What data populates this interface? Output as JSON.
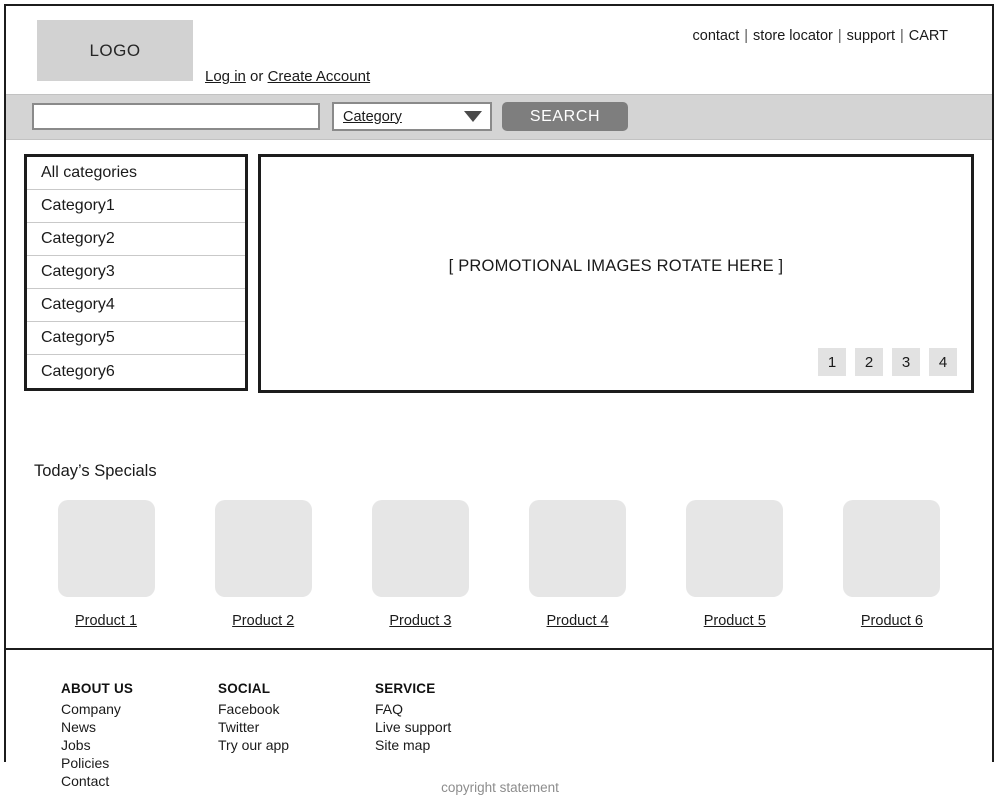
{
  "header": {
    "logo_label": "LOGO",
    "account": {
      "login_label": "Log in",
      "conjunction": " or ",
      "create_account_label": "Create Account"
    },
    "top_nav": [
      {
        "label": "contact"
      },
      {
        "label": "store locator"
      },
      {
        "label": "support"
      },
      {
        "label": "CART"
      }
    ],
    "nav_separator": "|"
  },
  "search": {
    "query_value": "",
    "placeholder": "",
    "category_label": "Category",
    "category_icon": "chevron-down-icon",
    "button_label": "SEARCH"
  },
  "categories": [
    {
      "label": "All categories"
    },
    {
      "label": "Category1"
    },
    {
      "label": "Category2"
    },
    {
      "label": "Category3"
    },
    {
      "label": "Category4"
    },
    {
      "label": "Category5"
    },
    {
      "label": "Category6"
    }
  ],
  "promo": {
    "placeholder_text": "[ PROMOTIONAL IMAGES ROTATE HERE ]",
    "pager": [
      "1",
      "2",
      "3",
      "4"
    ]
  },
  "specials": {
    "title": "Today’s Specials",
    "products": [
      {
        "name": "Product 1"
      },
      {
        "name": "Product 2"
      },
      {
        "name": "Product 3"
      },
      {
        "name": "Product 4"
      },
      {
        "name": "Product 5"
      },
      {
        "name": "Product 6"
      }
    ]
  },
  "footer": {
    "columns": [
      {
        "heading": "ABOUT US",
        "links": [
          {
            "label": "Company"
          },
          {
            "label": "News"
          },
          {
            "label": "Jobs"
          },
          {
            "label": "Policies"
          },
          {
            "label": "Contact"
          }
        ]
      },
      {
        "heading": "SOCIAL",
        "links": [
          {
            "label": "Facebook"
          },
          {
            "label": "Twitter"
          },
          {
            "label": "Try our app"
          }
        ]
      },
      {
        "heading": "SERVICE",
        "links": [
          {
            "label": "FAQ"
          },
          {
            "label": "Live support"
          },
          {
            "label": "Site map"
          }
        ]
      }
    ]
  },
  "copyright": "copyright statement",
  "colors": {
    "frame": "#1c1c1c",
    "search_band": "#d4d4d4",
    "search_button": "#7e7e7e",
    "logo_box": "#d2d2d2",
    "product_thumb": "#e6e6e6",
    "pager": "#e2e2e2",
    "copyright_text": "#8d8d8d"
  }
}
